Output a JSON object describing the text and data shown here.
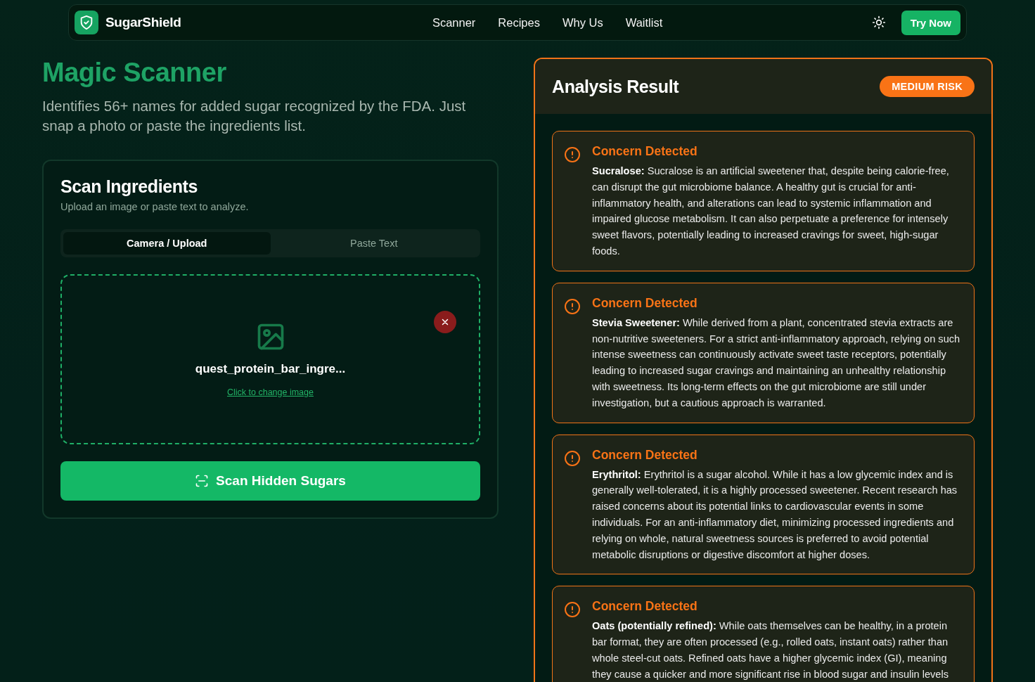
{
  "nav": {
    "brand": "SugarShield",
    "links": [
      "Scanner",
      "Recipes",
      "Why Us",
      "Waitlist"
    ],
    "cta": "Try Now"
  },
  "hero": {
    "title": "Magic Scanner",
    "subtitle": "Identifies 56+ names for added sugar recognized by the FDA. Just snap a photo or paste the ingredients list."
  },
  "scan_card": {
    "title": "Scan Ingredients",
    "subtitle": "Upload an image or paste text to analyze.",
    "tabs": [
      {
        "label": "Camera / Upload",
        "selected": true
      },
      {
        "label": "Paste Text",
        "selected": false
      }
    ],
    "upload": {
      "file_name": "quest_protein_bar_ingre...",
      "change_link": "Click to change image"
    },
    "scan_button": "Scan Hidden Sugars"
  },
  "result": {
    "title": "Analysis Result",
    "risk": {
      "label": "MEDIUM RISK",
      "kind": "medium"
    },
    "concerns": [
      {
        "title": "Concern Detected",
        "text": "**Sucralose:** Sucralose is an artificial sweetener that, despite being calorie-free, can disrupt the gut microbiome balance. A healthy gut is crucial for anti-inflammatory health, and alterations can lead to systemic inflammation and impaired glucose metabolism. It can also perpetuate a preference for intensely sweet flavors, potentially leading to increased cravings for sweet, high-sugar foods."
      },
      {
        "title": "Concern Detected",
        "text": "**Stevia Sweetener:** While derived from a plant, concentrated stevia extracts are non-nutritive sweeteners. For a strict anti-inflammatory approach, relying on such intense sweetness can continuously activate sweet taste receptors, potentially leading to increased sugar cravings and maintaining an unhealthy relationship with sweetness. Its long-term effects on the gut microbiome are still under investigation, but a cautious approach is warranted."
      },
      {
        "title": "Concern Detected",
        "text": "**Erythritol:** Erythritol is a sugar alcohol. While it has a low glycemic index and is generally well-tolerated, it is a highly processed sweetener. Recent research has raised concerns about its potential links to cardiovascular events in some individuals. For an anti-inflammatory diet, minimizing processed ingredients and relying on whole, natural sweetness sources is preferred to avoid potential metabolic disruptions or digestive discomfort at higher doses."
      },
      {
        "title": "Concern Detected",
        "text": "**Oats (potentially refined):** While oats themselves can be healthy, in a protein bar format, they are often processed (e.g., rolled oats, instant oats) rather than whole steel-cut oats. Refined oats have a higher glycemic index (GI), meaning they cause a quicker and more significant rise in blood sugar and insulin levels"
      }
    ]
  }
}
